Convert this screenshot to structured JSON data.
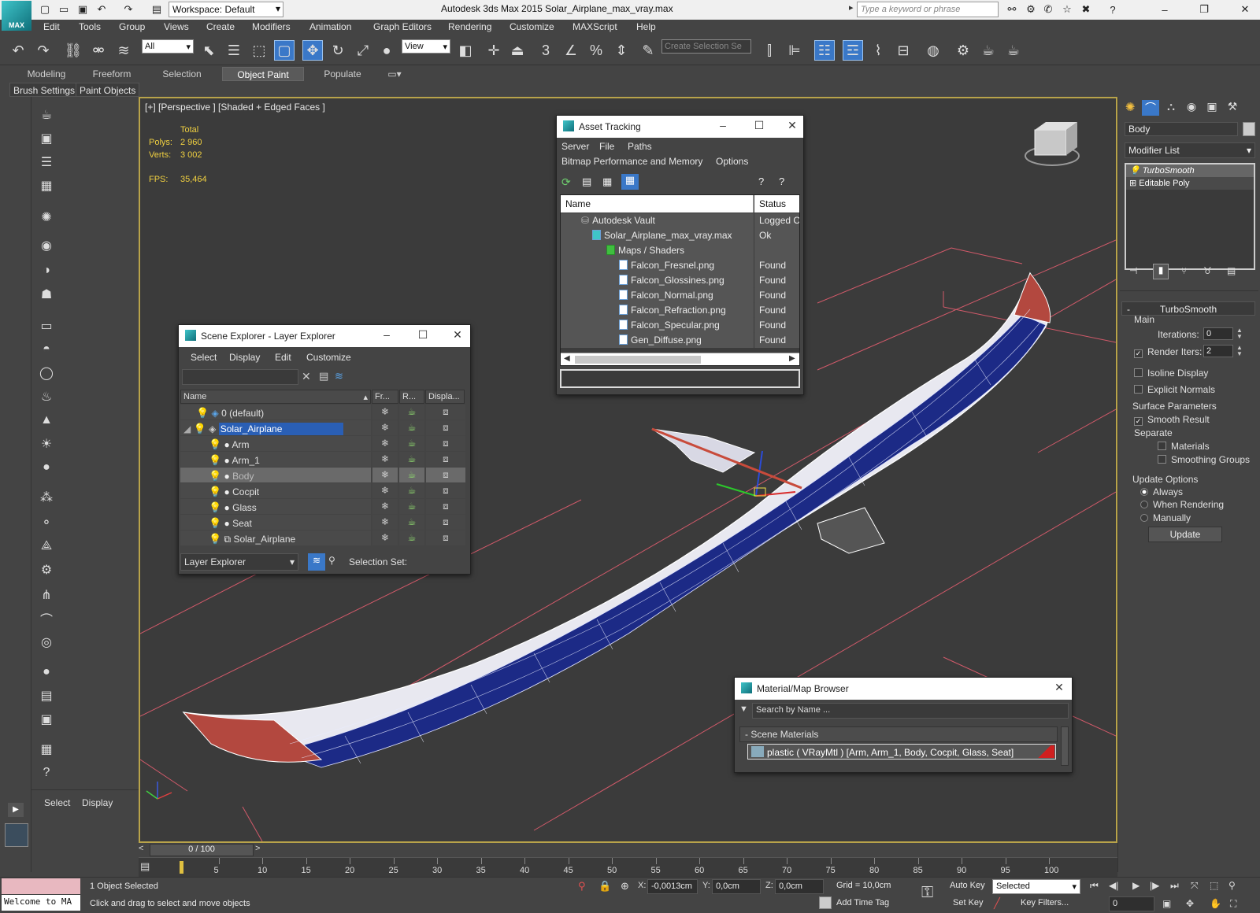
{
  "app": {
    "title": "Autodesk 3ds Max  2015    Solar_Airplane_max_vray.max",
    "logo_text": "MAX",
    "workspace": "Workspace: Default",
    "search_placeholder": "Type a keyword or phrase"
  },
  "menu": [
    "Edit",
    "Tools",
    "Group",
    "Views",
    "Create",
    "Modifiers",
    "Animation",
    "Graph Editors",
    "Rendering",
    "Customize",
    "MAXScript",
    "Help"
  ],
  "toolbar": {
    "filter_value": "All",
    "refcoord_value": "View",
    "selection_set_placeholder": "Create Selection Se",
    "snap_3": "3"
  },
  "ribbon": {
    "tabs": [
      "Modeling",
      "Freeform",
      "Selection",
      "Object Paint",
      "Populate"
    ],
    "active_tab": "Object Paint",
    "subtabs": [
      "Brush Settings",
      "Paint Objects"
    ]
  },
  "viewport": {
    "label": "[+] [Perspective ] [Shaded + Edged Faces ]",
    "stats": {
      "total_label": "Total",
      "polys_label": "Polys:",
      "polys_value": "2 960",
      "verts_label": "Verts:",
      "verts_value": "3 002",
      "fps_label": "FPS:",
      "fps_value": "35,464"
    }
  },
  "asset_tracking": {
    "title": "Asset Tracking",
    "menu_row1": [
      "Server",
      "File",
      "Paths"
    ],
    "menu_row2": [
      "Bitmap Performance and Memory",
      "Options"
    ],
    "columns": [
      "Name",
      "Status"
    ],
    "rows": [
      {
        "name": "Autodesk Vault",
        "status": "Logged O"
      },
      {
        "name": "Solar_Airplane_max_vray.max",
        "status": "Ok"
      },
      {
        "name": "Maps / Shaders",
        "status": ""
      },
      {
        "name": "Falcon_Fresnel.png",
        "status": "Found"
      },
      {
        "name": "Falcon_Glossines.png",
        "status": "Found"
      },
      {
        "name": "Falcon_Normal.png",
        "status": "Found"
      },
      {
        "name": "Falcon_Refraction.png",
        "status": "Found"
      },
      {
        "name": "Falcon_Specular.png",
        "status": "Found"
      },
      {
        "name": "Gen_Diffuse.png",
        "status": "Found"
      }
    ]
  },
  "scene_explorer": {
    "title": "Scene Explorer - Layer Explorer",
    "menu": [
      "Select",
      "Display",
      "Edit",
      "Customize"
    ],
    "columns": [
      "Name",
      "Fr...",
      "R...",
      "Displa..."
    ],
    "rows": [
      {
        "name": "0 (default)"
      },
      {
        "name": "Solar_Airplane"
      },
      {
        "name": "Arm"
      },
      {
        "name": "Arm_1"
      },
      {
        "name": "Body"
      },
      {
        "name": "Cocpit"
      },
      {
        "name": "Glass"
      },
      {
        "name": "Seat"
      },
      {
        "name": "Solar_Airplane"
      }
    ],
    "footer_mode": "Layer Explorer",
    "selection_set_label": "Selection Set:"
  },
  "material_browser": {
    "title": "Material/Map Browser",
    "search_placeholder": "Search by Name ...",
    "group": "Scene Materials",
    "item": "plastic  ( VRayMtl )  [Arm, Arm_1, Body, Cocpit, Glass, Seat]"
  },
  "command_panel": {
    "object_name": "Body",
    "modifier_list": "Modifier List",
    "stack": [
      "TurboSmooth",
      "Editable Poly"
    ],
    "rollout_title": "TurboSmooth",
    "main_label": "Main",
    "iterations_label": "Iterations:",
    "iterations_value": "0",
    "render_iters_label": "Render Iters:",
    "render_iters_value": "2",
    "isoline_label": "Isoline Display",
    "explicit_label": "Explicit Normals",
    "surface_label": "Surface Parameters",
    "smooth_result_label": "Smooth Result",
    "separate_label": "Separate",
    "materials_label": "Materials",
    "smoothing_groups_label": "Smoothing Groups",
    "update_options_label": "Update Options",
    "always_label": "Always",
    "when_rendering_label": "When Rendering",
    "manually_label": "Manually",
    "update_button": "Update"
  },
  "left_panel": {
    "select_label": "Select",
    "display_label": "Display"
  },
  "timeline": {
    "frame_display": "0 / 100",
    "ticks": [
      "5",
      "10",
      "15",
      "20",
      "25",
      "30",
      "35",
      "40",
      "45",
      "50",
      "55",
      "60",
      "65",
      "70",
      "75",
      "80",
      "85",
      "90",
      "95",
      "100"
    ]
  },
  "status": {
    "maxscript_text": "Welcome to MA",
    "selected_text": "1 Object Selected",
    "prompt_text": "Click and drag to select and move objects",
    "x_label": "X:",
    "x_value": "-0,0013cm",
    "y_label": "Y:",
    "y_value": "0,0cm",
    "z_label": "Z:",
    "z_value": "0,0cm",
    "grid_text": "Grid = 10,0cm",
    "add_time_tag": "Add Time Tag",
    "auto_key": "Auto Key",
    "set_key": "Set Key",
    "selected_dropdown": "Selected",
    "key_filters": "Key Filters...",
    "frame_value": "0"
  }
}
